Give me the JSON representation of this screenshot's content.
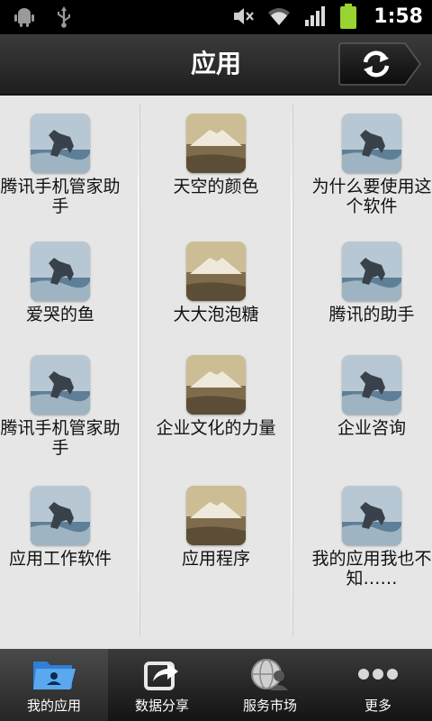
{
  "status": {
    "time": "1:58",
    "icons": [
      "android-debug-icon",
      "usb-icon",
      "mute-icon",
      "wifi-icon",
      "signal-icon",
      "battery-icon"
    ]
  },
  "header": {
    "title": "应用",
    "refresh_icon": "refresh-icon"
  },
  "apps": [
    {
      "label": "腾讯手机管家助手",
      "thumb": "horse"
    },
    {
      "label": "天空的颜色",
      "thumb": "mountain"
    },
    {
      "label": "为什么要使用这个软件",
      "thumb": "horse"
    },
    {
      "label": "爱哭的鱼",
      "thumb": "horse"
    },
    {
      "label": "大大泡泡糖",
      "thumb": "mountain"
    },
    {
      "label": "腾讯的助手",
      "thumb": "horse"
    },
    {
      "label": "腾讯手机管家助手",
      "thumb": "horse"
    },
    {
      "label": "企业文化的力量",
      "thumb": "mountain"
    },
    {
      "label": "企业咨询",
      "thumb": "horse"
    },
    {
      "label": "应用工作软件",
      "thumb": "horse"
    },
    {
      "label": "应用程序",
      "thumb": "mountain"
    },
    {
      "label": "我的应用我也不知……",
      "thumb": "horse"
    }
  ],
  "tabs": [
    {
      "label": "我的应用",
      "icon": "folder-user-icon",
      "active": true
    },
    {
      "label": "数据分享",
      "icon": "share-icon",
      "active": false
    },
    {
      "label": "服务市场",
      "icon": "globe-user-icon",
      "active": false
    },
    {
      "label": "更多",
      "icon": "more-dots-icon",
      "active": false
    }
  ],
  "colors": {
    "content_bg": "#e6e6e6",
    "bar_dark": "#1e1e1e",
    "battery": "#9ad431",
    "folder_blue": "#3a8fe0"
  }
}
